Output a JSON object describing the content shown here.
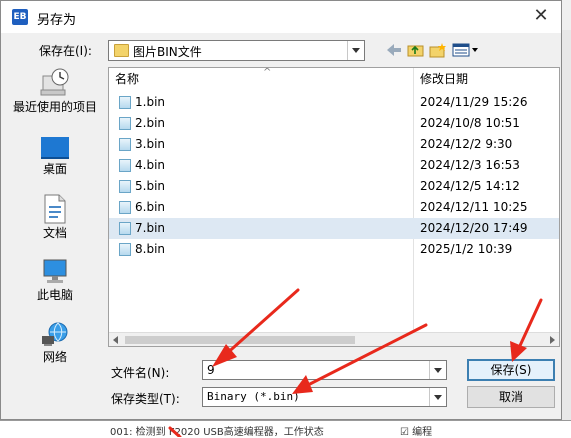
{
  "dialog": {
    "title": "另存为",
    "title_icon_text": "EB",
    "close_symbol": "✕",
    "save_in_label": "保存在(I):",
    "save_in_value": "图片BIN文件"
  },
  "places": [
    {
      "label": "最近使用的项目",
      "icon": "recent-icon"
    },
    {
      "label": "桌面",
      "icon": "desktop-icon"
    },
    {
      "label": "文档",
      "icon": "documents-icon"
    },
    {
      "label": "此电脑",
      "icon": "computer-icon"
    },
    {
      "label": "网络",
      "icon": "network-icon"
    }
  ],
  "file_list": {
    "columns": [
      "名称",
      "修改日期"
    ],
    "rows": [
      {
        "name": "1.bin",
        "date": "2024/11/29 15:26"
      },
      {
        "name": "2.bin",
        "date": "2024/10/8 10:51"
      },
      {
        "name": "3.bin",
        "date": "2024/12/2 9:30"
      },
      {
        "name": "4.bin",
        "date": "2024/12/3 16:53"
      },
      {
        "name": "5.bin",
        "date": "2024/12/5 14:12"
      },
      {
        "name": "6.bin",
        "date": "2024/12/11 10:25"
      },
      {
        "name": "7.bin",
        "date": "2024/12/20 17:49",
        "selected": true
      },
      {
        "name": "8.bin",
        "date": "2025/1/2 10:39"
      }
    ]
  },
  "form": {
    "filename_label": "文件名(N):",
    "filename_value": "9",
    "filetype_label": "保存类型(T):",
    "filetype_value": "Binary (*.bin)"
  },
  "buttons": {
    "save": "保存(S)",
    "cancel": "取消"
  },
  "background_app": {
    "status_text": "001: 检测到 F2020 USB高速编程器，工作状态",
    "checkbox_label": "编程"
  },
  "colors": {
    "selection": "#dde8f3",
    "annotation_arrow": "#e8291c",
    "default_button_border": "#3c7fb1"
  }
}
